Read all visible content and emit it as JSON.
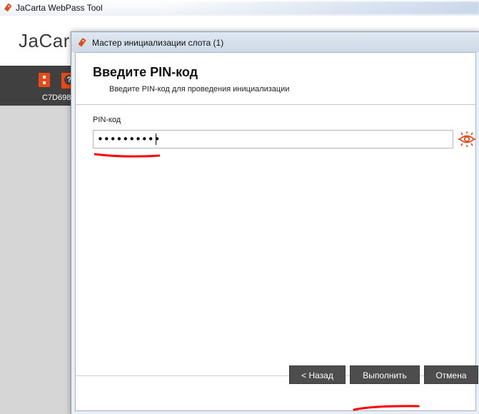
{
  "app": {
    "title": "JaCarta WebPass Tool",
    "logo": "JaCar",
    "token_label": "C7D698",
    "help_glyph": "?"
  },
  "dialog": {
    "title": "Мастер инициализации слота (1)",
    "heading": "Введите PIN-код",
    "subheading": "Введите PIN-код для проведения инициализации",
    "pin_label": "PIN-код",
    "pin_value": "••••••••••",
    "buttons": {
      "back": "< Назад",
      "execute": "Выполнить",
      "cancel": "Отмена"
    }
  },
  "icons": {
    "app_icon": "usb-token-icon",
    "dialog_icon": "usb-token-icon",
    "show_password": "eye-icon",
    "help": "help-icon",
    "token": "token-icon"
  },
  "colors": {
    "accent": "#e64a19",
    "dark_bar": "#404040",
    "button_bg": "#4d4d4d",
    "annotation_red": "#ff0000"
  }
}
